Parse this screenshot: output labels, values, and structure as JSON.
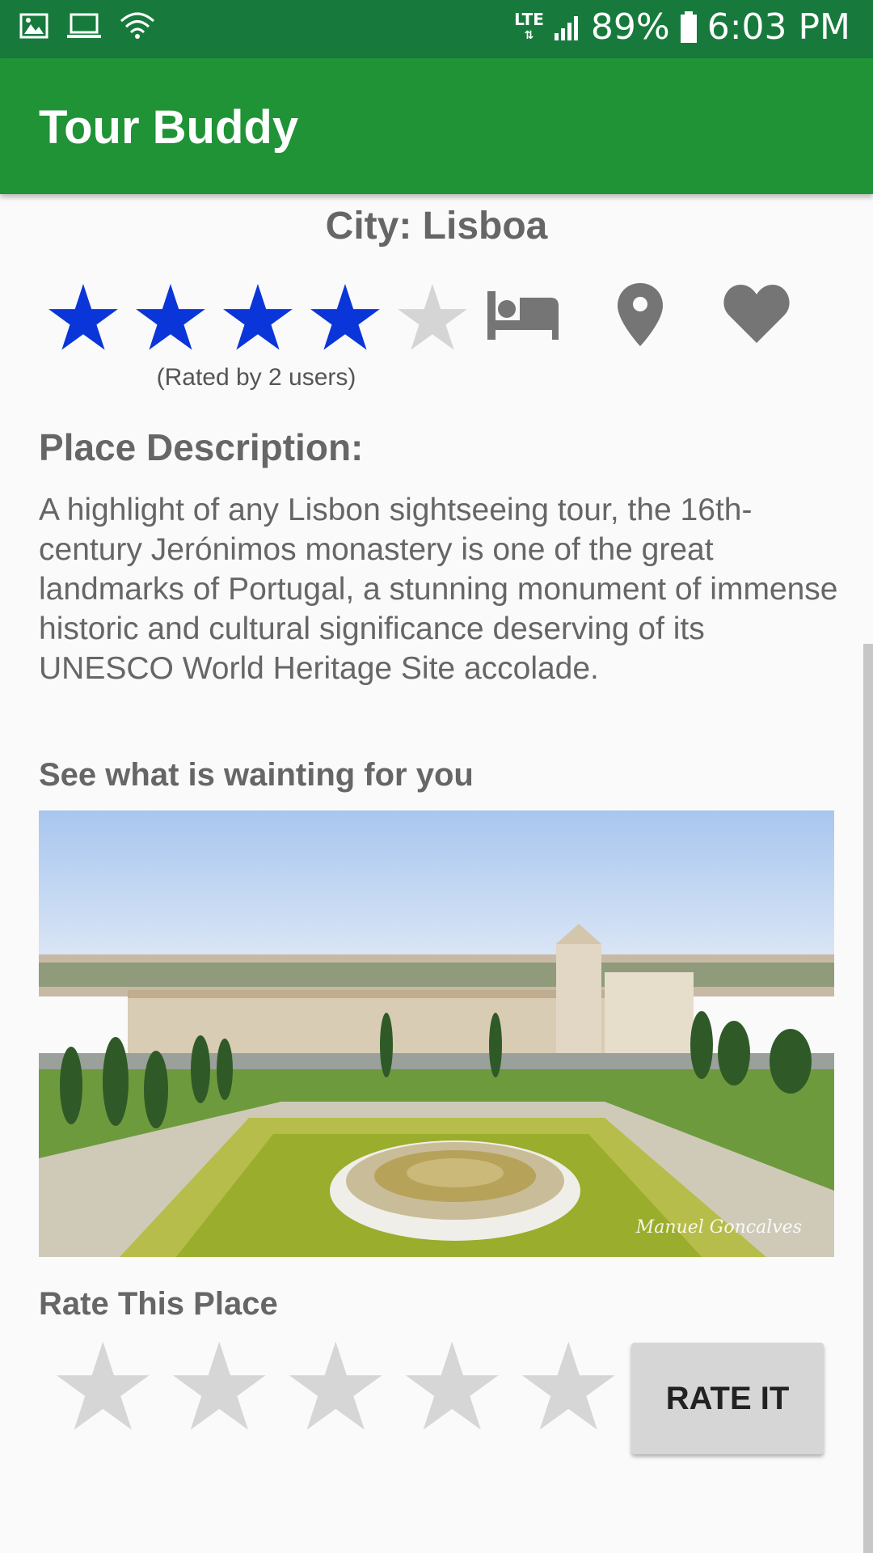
{
  "status_bar": {
    "network": "LTE",
    "battery": "89%",
    "time": "6:03 PM",
    "icons": [
      "image-icon",
      "laptop-icon",
      "wifi-icon",
      "signal-icon",
      "battery-icon"
    ]
  },
  "app_bar": {
    "title": "Tour Buddy"
  },
  "place": {
    "city": "City: Lisboa",
    "rating": 4,
    "rating_max": 5,
    "rated_by": "(Rated by 2 users)",
    "action_icons": [
      "bed-icon",
      "location-pin-icon",
      "heart-icon"
    ]
  },
  "description": {
    "heading": "Place Description:",
    "text": "A highlight of any Lisbon sightseeing tour, the 16th-century Jerónimos monastery is one of the great landmarks of Portugal, a stunning monument of immense historic and cultural significance deserving of its UNESCO World Heritage Site accolade."
  },
  "gallery": {
    "heading": "See what is wainting for you",
    "watermark": "Manuel Goncalves"
  },
  "rate": {
    "heading": "Rate This Place",
    "stars": 0,
    "button_label": "RATE IT"
  },
  "colors": {
    "status_bar": "#177a3c",
    "app_bar": "#1f9336",
    "star_filled": "#0a35d8",
    "star_empty": "#d5d5d5",
    "icon_gray": "#757575"
  }
}
